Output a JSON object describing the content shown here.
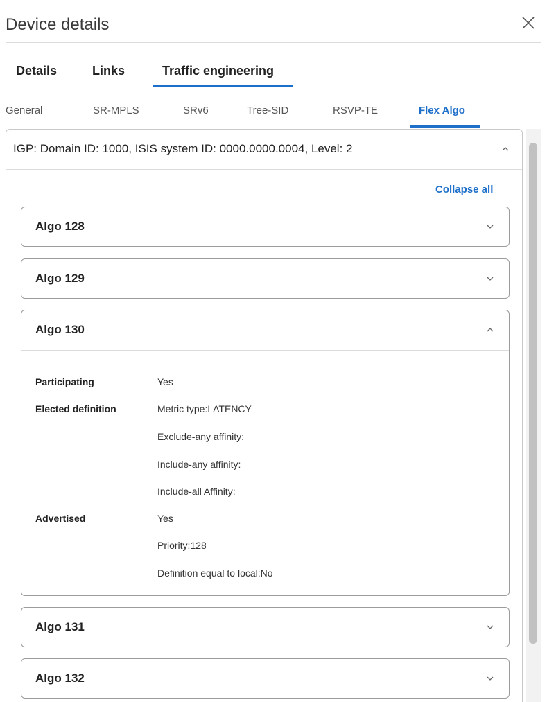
{
  "header": {
    "title": "Device details"
  },
  "main_tabs": [
    {
      "label": "Details"
    },
    {
      "label": "Links"
    },
    {
      "label": "Traffic engineering",
      "active": true
    }
  ],
  "sub_tabs": [
    {
      "label": "General"
    },
    {
      "label": "SR-MPLS"
    },
    {
      "label": "SRv6"
    },
    {
      "label": "Tree-SID"
    },
    {
      "label": "RSVP-TE"
    },
    {
      "label": "Flex Algo",
      "active": true
    }
  ],
  "igp_panel": {
    "title": "IGP: Domain ID: 1000, ISIS system ID: 0000.0000.0004, Level: 2",
    "expanded": true,
    "collapse_all_label": "Collapse all"
  },
  "algos": [
    {
      "title": "Algo 128",
      "expanded": false
    },
    {
      "title": "Algo 129",
      "expanded": false
    },
    {
      "title": "Algo 130",
      "expanded": true,
      "details": {
        "participating_label": "Participating",
        "participating_value": "Yes",
        "elected_label": "Elected definition",
        "elected_values": [
          "Metric type:LATENCY",
          "Exclude-any affinity:",
          "Include-any affinity:",
          "Include-all Affinity:"
        ],
        "advertised_label": "Advertised",
        "advertised_values": [
          "Yes",
          "Priority:128",
          "Definition equal to local:No"
        ]
      }
    },
    {
      "title": "Algo 131",
      "expanded": false
    },
    {
      "title": "Algo 132",
      "expanded": false
    }
  ],
  "colors": {
    "accent": "#1d6fc9",
    "border": "#9c9c9c",
    "divider": "#dcdcdc"
  }
}
